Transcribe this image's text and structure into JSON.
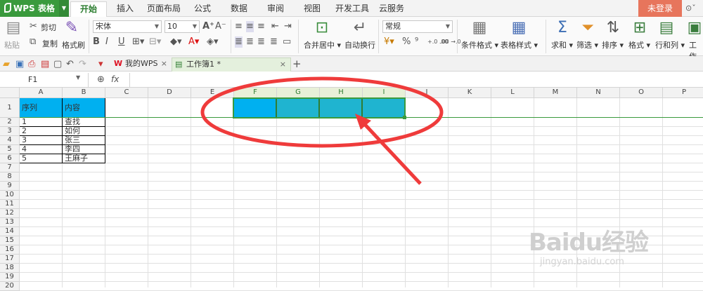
{
  "app": {
    "name": "WPS 表格",
    "login": "未登录"
  },
  "menu": {
    "tabs": [
      "开始",
      "插入",
      "页面布局",
      "公式",
      "数据",
      "审阅",
      "视图",
      "开发工具",
      "云服务"
    ],
    "active": "开始"
  },
  "ribbon": {
    "paste": "粘贴",
    "cut": "剪切",
    "copy": "复制",
    "format_painter": "格式刷",
    "font_name": "宋体",
    "font_size": "10",
    "merge_center": "合并居中",
    "wrap_text": "自动换行",
    "number_format": "常规",
    "percent": "%",
    "comma": "⁹",
    "inc_decimal": "+.0 .00",
    "dec_decimal": ".00 →.0",
    "cond_format": "条件格式",
    "table_style": "表格样式",
    "sum": "求和",
    "filter": "筛选",
    "sort": "排序",
    "format": "格式",
    "row_col": "行和列",
    "worksheet": "工作"
  },
  "doc_tabs": [
    {
      "label": "我的WPS"
    },
    {
      "label": "工作簿1 *"
    }
  ],
  "formula_bar": {
    "name_box": "F1",
    "fx": "fx"
  },
  "columns": [
    "A",
    "B",
    "C",
    "D",
    "E",
    "F",
    "G",
    "H",
    "I",
    "J",
    "K",
    "L",
    "M",
    "N",
    "O",
    "P"
  ],
  "selected_columns": [
    "F",
    "G",
    "H",
    "I"
  ],
  "rows": [
    "1",
    "2",
    "3",
    "4",
    "5",
    "6",
    "7",
    "8",
    "9",
    "10",
    "11",
    "12",
    "13",
    "14",
    "15",
    "16",
    "17",
    "18",
    "19",
    "20"
  ],
  "table": {
    "headers": [
      "序列",
      "内容"
    ],
    "data": [
      [
        "1",
        "查找"
      ],
      [
        "2",
        "如何"
      ],
      [
        "3",
        "张三"
      ],
      [
        "4",
        "李四"
      ],
      [
        "5",
        "王麻子"
      ]
    ]
  },
  "colors": {
    "accent": "#3a9a3d",
    "header_fill": "#00b0f0",
    "selection_fill": "#1fb4d0",
    "annotation": "#ef3b3b"
  },
  "watermark": {
    "brand": "Baidu经验",
    "url": "jingyan.baidu.com"
  }
}
